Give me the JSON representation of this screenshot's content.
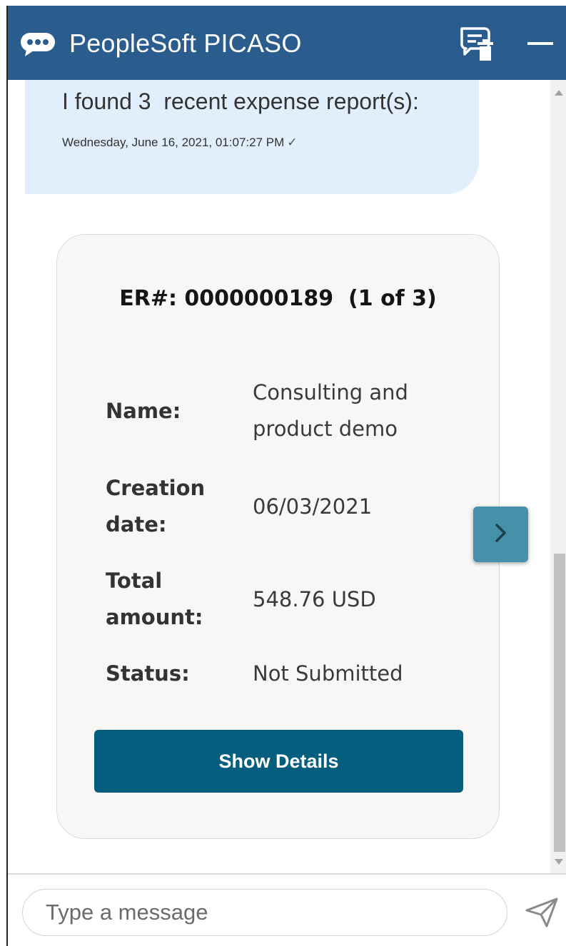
{
  "header": {
    "title": "PeopleSoft PICASO",
    "logo_icon": "chat-bubble-icon",
    "clear_icon": "clear-history-icon",
    "minimize_icon": "minimize-icon"
  },
  "conversation": {
    "bot_message": {
      "text": "I found 3  recent expense report(s):",
      "timestamp": "Wednesday, June 16, 2021, 01:07:27 PM",
      "check": "✓"
    },
    "card": {
      "title": "ER#: 0000000189  (1 of 3)",
      "fields": [
        {
          "label": "Name:",
          "value": "Consulting and product demo"
        },
        {
          "label": "Creation date:",
          "value": "06/03/2021"
        },
        {
          "label": "Total amount:",
          "value": "548.76 USD"
        },
        {
          "label": "Status:",
          "value": "Not Submitted"
        }
      ],
      "button_label": "Show Details"
    },
    "next_icon": "chevron-right-icon"
  },
  "footer": {
    "input_placeholder": "Type a message",
    "input_value": "",
    "send_icon": "send-icon"
  },
  "colors": {
    "header": "#2a5d8d",
    "bubble": "#e1eefc",
    "card": "#f8f7f6",
    "button": "#055e7e",
    "next_button": "#4591a9"
  }
}
